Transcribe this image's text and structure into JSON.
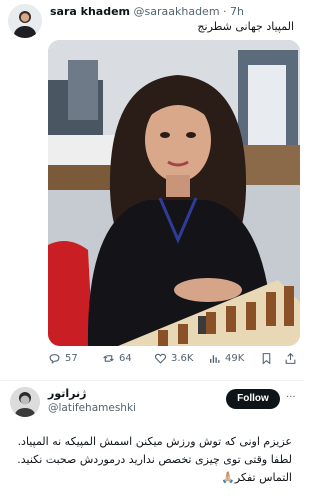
{
  "post": {
    "name": "sara khadem",
    "handle": "@saraakhadem",
    "sep": "·",
    "time": "7h",
    "text": "المپیاد جهانی شطرنج",
    "actions": {
      "replies": "57",
      "reposts": "64",
      "likes": "3.6K",
      "views": "49K"
    }
  },
  "reply": {
    "name": "ژنراتور",
    "handle": "@latifehameshki",
    "follow_label": "Follow",
    "more": "···",
    "text": "عزیزم اونی که توش ورزش میکنن اسمش المپیکه نه المپیاد. لطفا وقتی توی چیزی تخصص ندارید درموردش صحبت نکنید. التماس تفکر🙏🏼"
  },
  "colors": {
    "muted": "#536471",
    "text": "#0f1419",
    "button": "#0f1419"
  },
  "icons": [
    "reply-icon",
    "repost-icon",
    "like-icon",
    "views-icon",
    "bookmark-icon",
    "share-icon"
  ]
}
